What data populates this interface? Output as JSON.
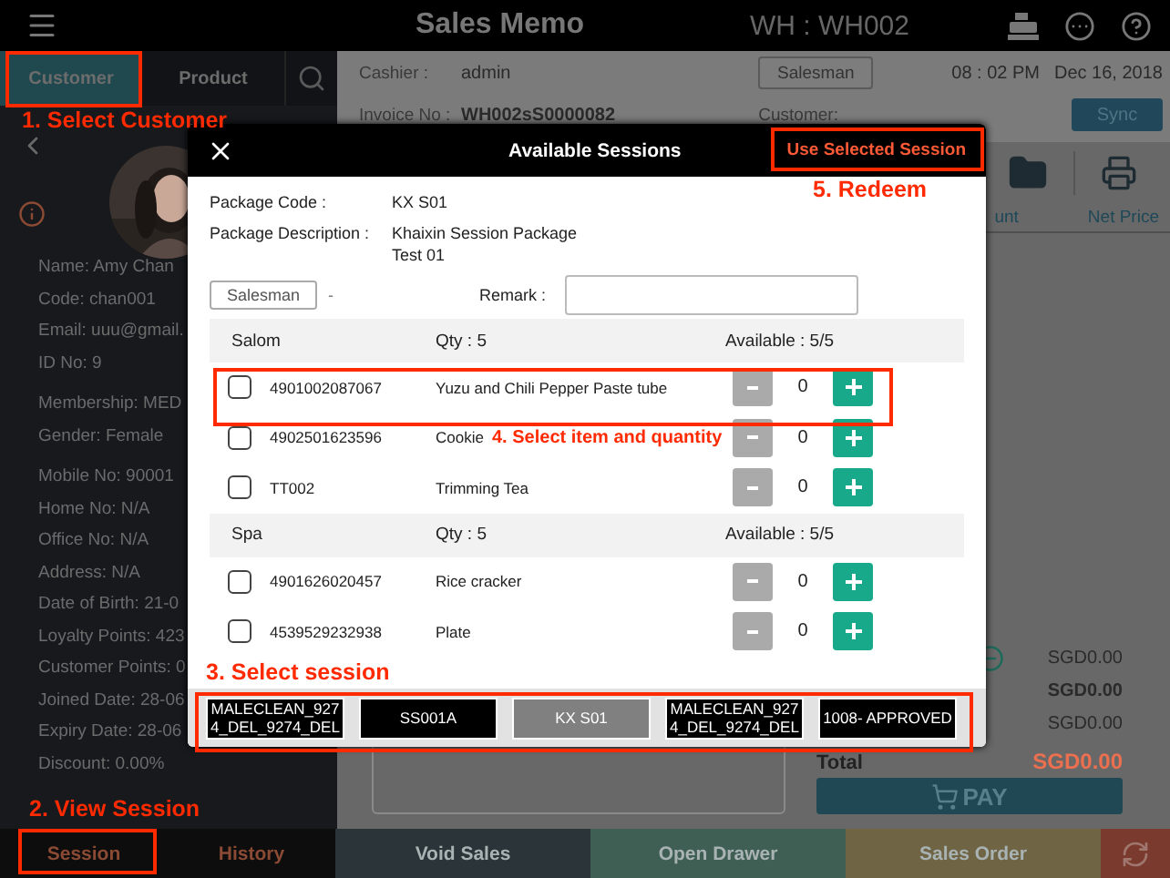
{
  "top_bar": {
    "title": "Sales Memo",
    "warehouse": "WH : WH002"
  },
  "left_tabs": [
    {
      "label": "Customer",
      "selected": true
    },
    {
      "label": "Product",
      "selected": false
    }
  ],
  "customer": {
    "detail_groups": [
      {
        "lines": [
          "Name: Amy Chan",
          "Code: chan001",
          "Email: uuu@gmail.",
          "ID No: 9"
        ]
      },
      {
        "lines": [
          "Membership: MED",
          "Gender: Female"
        ]
      },
      {
        "lines": [
          "Mobile No: 90001",
          "Home No: N/A",
          "Office No: N/A",
          "Address: N/A",
          "Date of Birth: 21-0",
          "Loyalty Points: 423",
          "Customer Points: 0",
          "Joined Date: 28-06",
          "Expiry Date: 28-06",
          "Discount: 0.00%"
        ]
      }
    ]
  },
  "invoice": {
    "cashier_label": "Cashier :",
    "cashier": "admin",
    "salesman_button": "Salesman",
    "time": "08 : 02 PM",
    "date": "Dec 16, 2018",
    "invoice_label": "Invoice No :",
    "invoice_no": "WH002sS0000082",
    "customer_label": "Customer:",
    "sync_button": "Sync"
  },
  "columns": [
    "unt",
    "Net Price"
  ],
  "totals": [
    {
      "value": "SGD0.00",
      "bold": false
    },
    {
      "value": "SGD0.00",
      "bold": true
    },
    {
      "value": "SGD0.00",
      "bold": false
    }
  ],
  "total": {
    "label": "Total",
    "value": "SGD0.00"
  },
  "pay_button": "PAY",
  "bottom_bar": [
    {
      "kind": "text",
      "label": "Session",
      "color": "#0d0d0d"
    },
    {
      "kind": "text",
      "label": "History",
      "color": "#0d0d0d"
    },
    {
      "kind": "text",
      "label": "Void Sales",
      "color": "#2b3539"
    },
    {
      "kind": "text",
      "label": "Open Drawer",
      "color": "#3f5f54"
    },
    {
      "kind": "text",
      "label": "Sales Order",
      "color": "#6f6545"
    },
    {
      "kind": "refresh",
      "color": "#7a3a2e"
    }
  ],
  "modal": {
    "title": "Available Sessions",
    "action": "Use Selected Session",
    "package_code_label": "Package Code :",
    "package_code": "KX S01",
    "package_description_label": "Package Description :",
    "package_description": "Khaixin Session Package Test 01",
    "salesman_button": "Salesman",
    "salesman": "-",
    "remark_label": "Remark :",
    "groups": [
      {
        "name": "Salom",
        "qty": "Qty : 5",
        "available": "Available : 5/5",
        "items": [
          {
            "code": "4901002087067",
            "name": "Yuzu and Chili Pepper Paste tube",
            "quantity": "0",
            "checked": false
          },
          {
            "code": "4902501623596",
            "name": "Cookie",
            "quantity": "0",
            "checked": false
          },
          {
            "code": "TT002",
            "name": "Trimming Tea",
            "quantity": "0",
            "checked": false
          }
        ]
      },
      {
        "name": "Spa",
        "qty": "Qty : 5",
        "available": "Available : 5/5",
        "items": [
          {
            "code": "4901626020457",
            "name": "Rice cracker",
            "quantity": "0",
            "checked": false
          },
          {
            "code": "4539529232938",
            "name": "Plate",
            "quantity": "0",
            "checked": false
          }
        ]
      }
    ],
    "sessions": [
      {
        "label": "MALECLEAN_9274_DEL_9274_DEL",
        "selected": false
      },
      {
        "label": "SS001A",
        "selected": false
      },
      {
        "label": "KX S01",
        "selected": true
      },
      {
        "label": "MALECLEAN_9274_DEL_9274_DEL",
        "selected": false
      },
      {
        "label": "1008- APPROVED",
        "selected": false
      }
    ]
  },
  "annotations": [
    "1. Select Customer",
    "2. View Session",
    "3. Select session",
    "4. Select item and quantity",
    "5. Redeem"
  ]
}
